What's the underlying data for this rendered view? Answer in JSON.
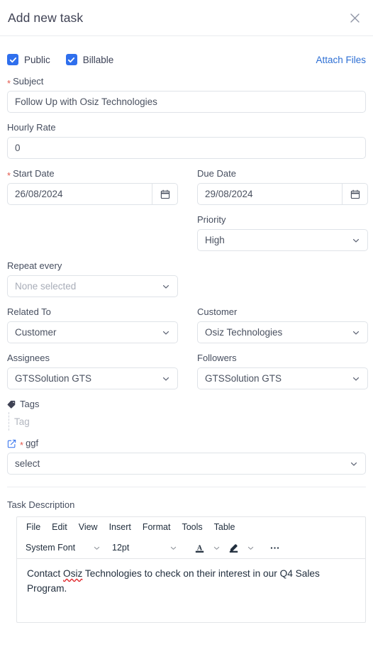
{
  "header": {
    "title": "Add new task",
    "close_icon": "close-icon"
  },
  "options": {
    "public_label": "Public",
    "public_checked": true,
    "billable_label": "Billable",
    "billable_checked": true,
    "attach_files_label": "Attach Files"
  },
  "fields": {
    "subject": {
      "label": "Subject",
      "required": true,
      "value": "Follow Up with Osiz Technologies"
    },
    "hourly_rate": {
      "label": "Hourly Rate",
      "required": false,
      "value": "0"
    },
    "start_date": {
      "label": "Start Date",
      "required": true,
      "value": "26/08/2024",
      "icon": "calendar-icon"
    },
    "due_date": {
      "label": "Due Date",
      "required": false,
      "value": "29/08/2024",
      "icon": "calendar-icon"
    },
    "priority": {
      "label": "Priority",
      "required": false,
      "value": "High"
    },
    "repeat_every": {
      "label": "Repeat every",
      "required": false,
      "value": "None selected",
      "is_placeholder": true
    },
    "related_to": {
      "label": "Related To",
      "required": false,
      "value": "Customer"
    },
    "customer": {
      "label": "Customer",
      "required": false,
      "value": "Osiz Technologies"
    },
    "assignees": {
      "label": "Assignees",
      "required": false,
      "value": "GTSSolution GTS"
    },
    "followers": {
      "label": "Followers",
      "required": false,
      "value": "GTSSolution GTS"
    },
    "tags": {
      "label": "Tags",
      "icon": "tag-icon",
      "placeholder": "Tag",
      "value": ""
    },
    "custom_ggf": {
      "label": "ggf",
      "required": true,
      "icon": "edit-square-icon",
      "value": "select"
    }
  },
  "task_description": {
    "label": "Task Description",
    "menu": [
      "File",
      "Edit",
      "View",
      "Insert",
      "Format",
      "Tools",
      "Table"
    ],
    "font_family": "System Font",
    "font_size": "12pt",
    "tools": [
      "text-color-icon",
      "chevron-down-icon",
      "highlight-color-icon",
      "chevron-down-icon",
      "more-options-icon"
    ],
    "body_before": "Contact ",
    "body_misspelled": "Osiz",
    "body_after": " Technologies to check on their interest in our Q4 Sales Program."
  },
  "colors": {
    "accent": "#2f6fed",
    "link": "#2d6fd4",
    "required": "#e2574c",
    "border": "#dfe3e8",
    "text": "#3c4257"
  }
}
